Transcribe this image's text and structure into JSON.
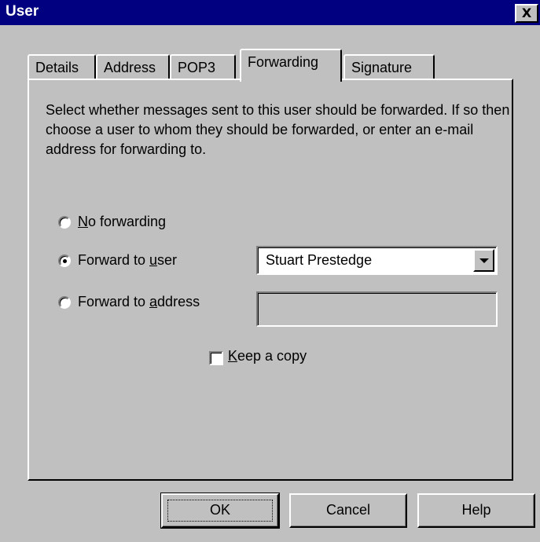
{
  "window": {
    "title": "User",
    "close_glyph": "X"
  },
  "tabs": [
    {
      "label": "Details",
      "active": false
    },
    {
      "label": "Address",
      "active": false
    },
    {
      "label": "POP3",
      "active": false
    },
    {
      "label": "Forwarding",
      "active": true
    },
    {
      "label": "Signature",
      "active": false
    }
  ],
  "forwarding": {
    "description": "Select whether messages sent to this user should be forwarded. If so then choose a user to whom they should be forwarded, or enter an e-mail address for forwarding to.",
    "options": {
      "no_forwarding": {
        "pre": "",
        "accel": "N",
        "post": "o forwarding",
        "checked": false
      },
      "forward_user": {
        "pre": "Forward to ",
        "accel": "u",
        "post": "ser",
        "checked": true
      },
      "forward_address": {
        "pre": "Forward to ",
        "accel": "a",
        "post": "ddress",
        "checked": false
      }
    },
    "user_select_value": "Stuart Prestedge",
    "address_value": "",
    "keep_copy": {
      "accel": "K",
      "post": "eep a copy",
      "checked": false
    }
  },
  "buttons": {
    "ok": "OK",
    "cancel": "Cancel",
    "help": "Help"
  },
  "icons": {
    "close": "close-icon",
    "dropdown": "chevron-down-icon"
  },
  "colors": {
    "titlebar": "#000080",
    "face": "#c0c0c0"
  }
}
